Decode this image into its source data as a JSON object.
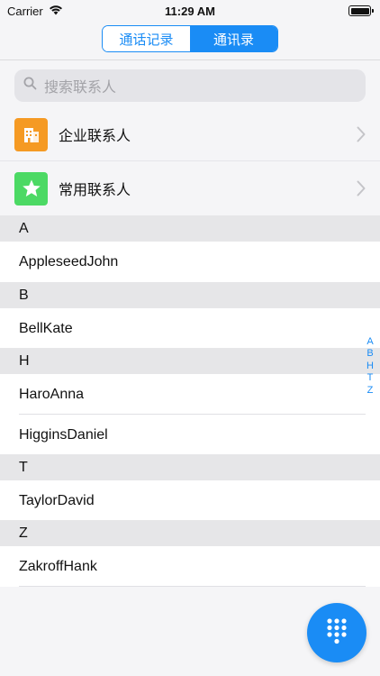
{
  "status_bar": {
    "carrier": "Carrier",
    "time": "11:29 AM",
    "battery_level": 1.0
  },
  "segmented": {
    "tabs": [
      {
        "label": "通话记录",
        "active": false
      },
      {
        "label": "通讯录",
        "active": true
      }
    ]
  },
  "search": {
    "placeholder": "搜索联系人",
    "icon": "search-icon"
  },
  "special_rows": [
    {
      "label": "企业联系人",
      "icon": "building-icon",
      "color": "#f59a23"
    },
    {
      "label": "常用联系人",
      "icon": "star-icon",
      "color": "#4cd964"
    }
  ],
  "sections": [
    {
      "letter": "A",
      "contacts": [
        "AppleseedJohn"
      ]
    },
    {
      "letter": "B",
      "contacts": [
        "BellKate"
      ]
    },
    {
      "letter": "H",
      "contacts": [
        "HaroAnna",
        "HigginsDaniel"
      ]
    },
    {
      "letter": "T",
      "contacts": [
        "TaylorDavid"
      ]
    },
    {
      "letter": "Z",
      "contacts": [
        "ZakroffHank"
      ]
    }
  ],
  "index_letters": [
    "A",
    "B",
    "H",
    "T",
    "Z"
  ],
  "fab": {
    "icon": "dialpad-icon"
  },
  "colors": {
    "accent": "#1a8cf5",
    "section_bg": "#e6e6e8",
    "background": "#f5f5f7"
  }
}
